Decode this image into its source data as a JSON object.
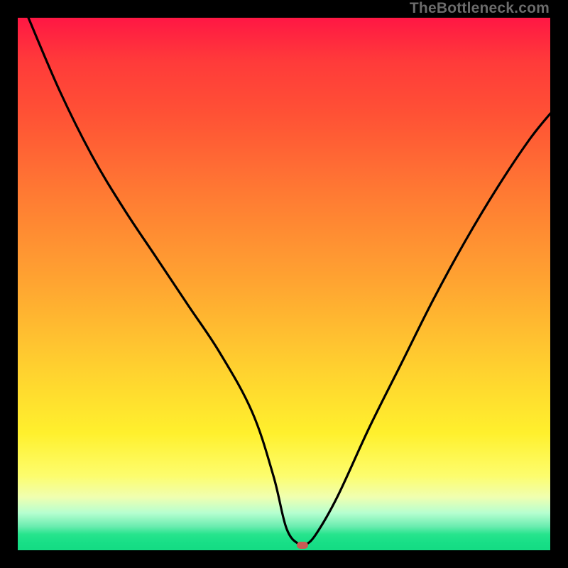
{
  "watermark": "TheBottleneck.com",
  "colors": {
    "curve": "#000000",
    "marker": "#c95a54",
    "frame": "#000000"
  },
  "chart_data": {
    "type": "line",
    "title": "",
    "xlabel": "",
    "ylabel": "",
    "xlim": [
      0,
      100
    ],
    "ylim": [
      0,
      100
    ],
    "grid": false,
    "legend": false,
    "series": [
      {
        "name": "bottleneck-curve",
        "x": [
          2,
          8,
          14,
          20,
          26,
          32,
          38,
          44,
          48,
          50.5,
          53,
          54,
          56,
          60,
          66,
          72,
          78,
          84,
          90,
          96,
          100
        ],
        "y": [
          100,
          86,
          74,
          64,
          55,
          46,
          37,
          26,
          14,
          4,
          1,
          1,
          3,
          10,
          23,
          35,
          47,
          58,
          68,
          77,
          82
        ]
      }
    ],
    "annotations": [
      {
        "name": "bottleneck-marker",
        "x": 53.5,
        "y": 1
      }
    ]
  }
}
